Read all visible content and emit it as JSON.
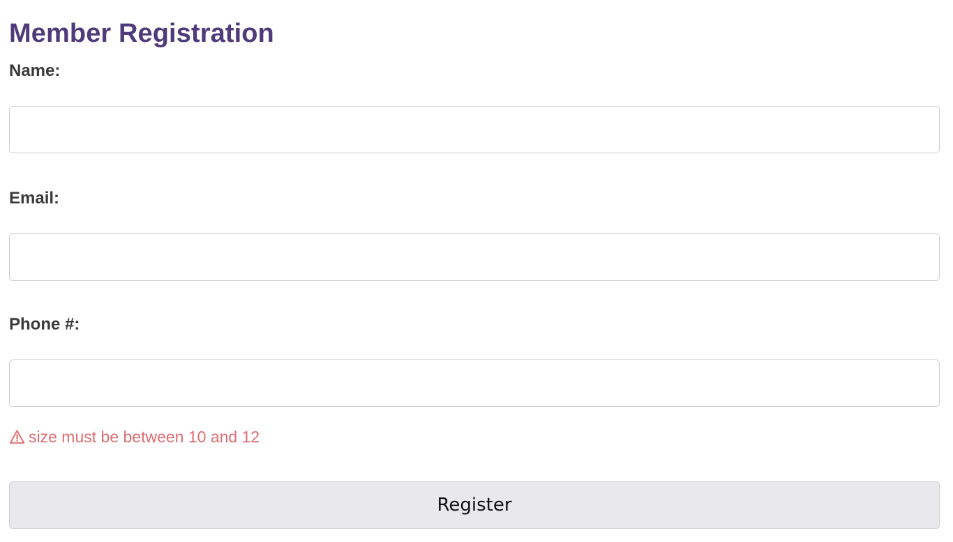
{
  "page": {
    "title": "Member Registration"
  },
  "form": {
    "name": {
      "label": "Name:",
      "value": "",
      "placeholder": ""
    },
    "email": {
      "label": "Email:",
      "value": "",
      "placeholder": ""
    },
    "phone": {
      "label": "Phone #:",
      "value": "",
      "placeholder": ""
    },
    "phone_error": {
      "icon": "warning-icon",
      "message": "size must be between 10 and 12"
    },
    "submit_label": "Register"
  },
  "colors": {
    "title": "#4f3a7a",
    "label": "#3a3a3a",
    "error": "#dd6e73",
    "button_background": "#e8e8ed",
    "input_border": "#cfcfd4"
  }
}
